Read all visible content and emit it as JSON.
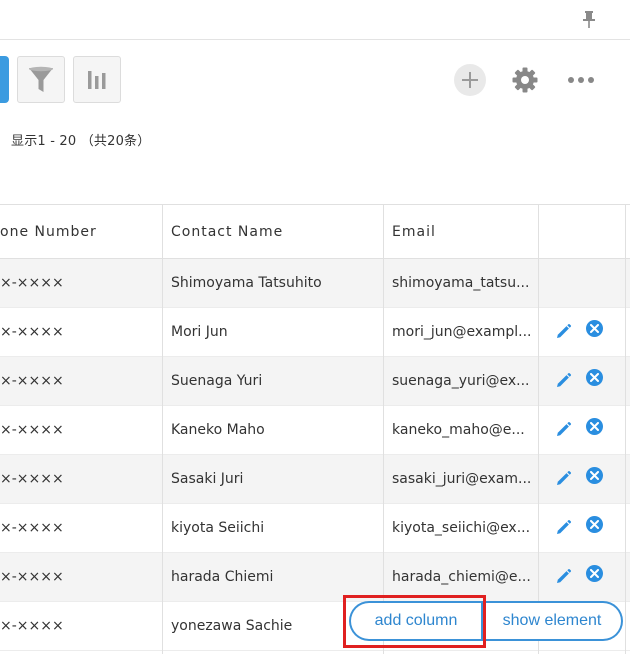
{
  "toolbar": {
    "summary": "显示1 - 20 （共20条）"
  },
  "table": {
    "headers": [
      "one Number",
      "Contact Name",
      "Email",
      ""
    ],
    "rows": [
      {
        "phone": "×-××××",
        "name": "Shimoyama Tatsuhito",
        "email": "shimoyama_tatsu...",
        "actions": false
      },
      {
        "phone": "×-××××",
        "name": "Mori Jun",
        "email": "mori_jun@exampl...",
        "actions": true
      },
      {
        "phone": "×-××××",
        "name": "Suenaga Yuri",
        "email": "suenaga_yuri@ex...",
        "actions": true
      },
      {
        "phone": "×-××××",
        "name": "Kaneko Maho",
        "email": "kaneko_maho@e...",
        "actions": true
      },
      {
        "phone": "×-××××",
        "name": "Sasaki Juri",
        "email": "sasaki_juri@exam...",
        "actions": true
      },
      {
        "phone": "×-××××",
        "name": "kiyota Seiichi",
        "email": "kiyota_seiichi@ex...",
        "actions": true
      },
      {
        "phone": "×-××××",
        "name": "harada Chiemi",
        "email": "harada_chiemi@e...",
        "actions": true
      },
      {
        "phone": "×-××××",
        "name": "yonezawa Sachie",
        "email": "",
        "actions": false
      }
    ]
  },
  "pills": {
    "add_column": "add column",
    "show_element": "show element"
  },
  "colors": {
    "accent": "#3b92d8",
    "delete": "#2a8ee0",
    "highlight": "#e02020"
  }
}
